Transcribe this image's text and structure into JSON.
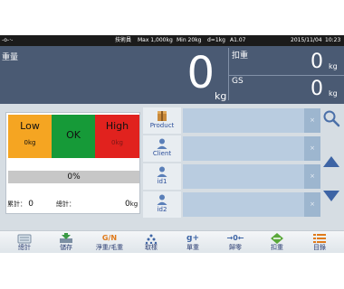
{
  "status": {
    "left_icons": "-o-·-",
    "user": "技術員",
    "max": "Max 1,000kg",
    "min": "Min 20kg",
    "d": "d=1kg",
    "version": "A1.07",
    "date": "2015/11/04",
    "time": "10:23"
  },
  "display": {
    "weight_label": "重量",
    "weight_value": "0",
    "weight_unit": "kg",
    "tare_label": "扣重",
    "tare_value": "0",
    "tare_unit": "kg",
    "gs_label": "GS",
    "gs_value": "0",
    "gs_unit": "kg"
  },
  "indicators": {
    "low_label": "Low",
    "low_value": "0kg",
    "ok_label": "OK",
    "high_label": "High",
    "high_value": "0kg"
  },
  "progress": {
    "label": "0%",
    "value": 0
  },
  "totals": {
    "count_label": "累計：",
    "count_value": "0",
    "sum_label": "總計：",
    "sum_value": "0",
    "sum_unit": "kg"
  },
  "fields": [
    {
      "label": "Product",
      "icon": "product-box-icon",
      "value": "",
      "clear": "×"
    },
    {
      "label": "Client",
      "icon": "client-person-icon",
      "value": "",
      "clear": "×"
    },
    {
      "label": "id1",
      "icon": "id-person-icon",
      "value": "",
      "clear": "×"
    },
    {
      "label": "id2",
      "icon": "id-person-icon",
      "value": "",
      "clear": "×"
    }
  ],
  "side_buttons": [
    "search-icon",
    "arrow-up-icon",
    "arrow-down-icon"
  ],
  "toolbar": [
    {
      "label": "總計",
      "icon": "total-icon"
    },
    {
      "label": "儲存",
      "icon": "save-icon"
    },
    {
      "label": "淨重/毛重",
      "icon": "net-gross-icon",
      "icon_text": "G/N"
    },
    {
      "label": "取樣",
      "icon": "sample-icon"
    },
    {
      "label": "單重",
      "icon": "unit-weight-icon",
      "icon_text": "g+"
    },
    {
      "label": "歸零",
      "icon": "zero-icon",
      "icon_text": "→0←"
    },
    {
      "label": "扣重",
      "icon": "tare-icon"
    },
    {
      "label": "目錄",
      "icon": "menu-list-icon"
    }
  ],
  "colors": {
    "display_bg": "#4a5a73",
    "low": "#f5a522",
    "ok": "#169a38",
    "high": "#e1221e",
    "field_bg": "#b9cce0",
    "accent": "#2c4f9a"
  }
}
